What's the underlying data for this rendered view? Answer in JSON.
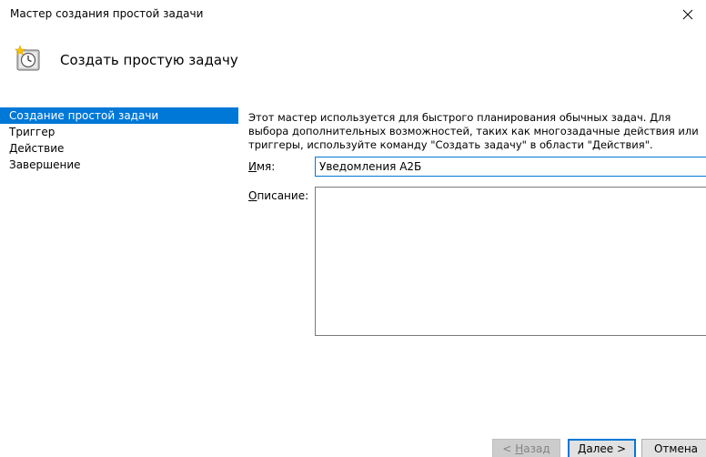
{
  "window": {
    "title": "Мастер создания простой задачи",
    "close_icon": "close-icon"
  },
  "header": {
    "title": "Создать простую задачу",
    "icon": "task-scheduler-clock-icon"
  },
  "nav": {
    "items": [
      {
        "label": "Создание простой задачи",
        "selected": true
      },
      {
        "label": "Триггер",
        "selected": false
      },
      {
        "label": "Действие",
        "selected": false
      },
      {
        "label": "Завершение",
        "selected": false
      }
    ]
  },
  "content": {
    "intro": "Этот мастер используется для быстрого планирования обычных задач.  Для выбора дополнительных возможностей, таких как многозадачные действия или триггеры, используйте команду \"Создать задачу\" в области \"Действия\".",
    "name_label_accel": "И",
    "name_label_rest": "мя:",
    "name_value": "Уведомления А2Б",
    "desc_label_accel": "О",
    "desc_label_rest": "писание:",
    "desc_value": ""
  },
  "buttons": {
    "back_prefix": "< ",
    "back_accel": "Н",
    "back_rest": "азад",
    "next_accel": "Д",
    "next_rest": "алее >",
    "cancel": "Отмена"
  },
  "colors": {
    "accent": "#0078d7",
    "selected_text": "#ffffff"
  }
}
